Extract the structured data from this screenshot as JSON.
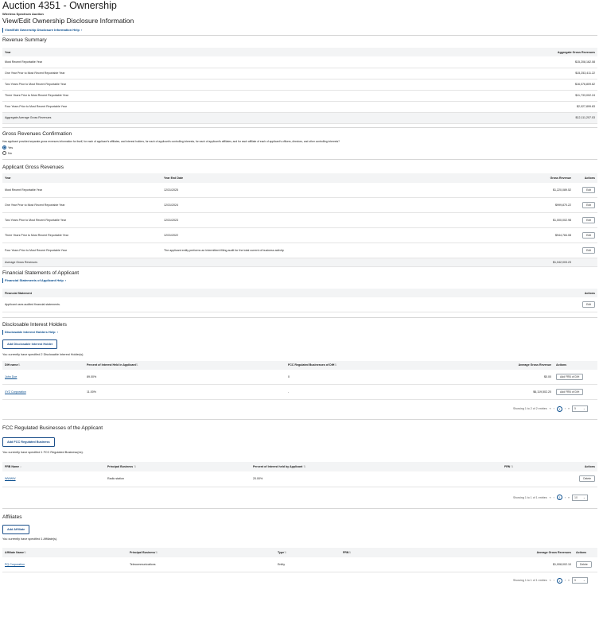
{
  "header": {
    "title": "Auction 4351 - Ownership",
    "subtitle": "Wireless Spectrum Auction",
    "heading": "View/Edit Ownership Disclosure Information",
    "help_link": "View/Edit Ownership Disclosure Information Help"
  },
  "revenue_summary": {
    "title": "Revenue Summary",
    "col_year": "Year",
    "col_agg": "Aggregate Gross Revenues",
    "rows": [
      {
        "year": "Most Recent Reportable Year",
        "value": "$15,208,162.08"
      },
      {
        "year": "One Year Prior to Most Recent Reportable Year",
        "value": "$15,253,411.22"
      },
      {
        "year": "Two Years Prior to Most Recent Reportable Year",
        "value": "$16,076,809.62"
      },
      {
        "year": "Three Years Prior to Most Recent Reportable Year",
        "value": "$11,733,002.24"
      },
      {
        "year": "Four Years Prior to Most Recent Reportable Year",
        "value": "$2,027,899.83"
      },
      {
        "year": "Aggregate Average Gross Revenues",
        "value": "$12,111,207.03"
      }
    ]
  },
  "confirmation": {
    "title": "Gross Revenues Confirmation",
    "question": "Has applicant provided separate gross revenues information for itself, for each of applicant's affiliates, and interest holders, for each of applicant's controlling interests, for each of applicant's affiliates, and for each affiliate of each of applicant's officers, directors, and other controlling interests?",
    "yes": "Yes",
    "no": "No"
  },
  "applicant_revenues": {
    "title": "Applicant Gross Revenues",
    "col_year": "Year",
    "col_end": "Year End Date",
    "col_rev": "Gross Revenue",
    "col_actions": "Actions",
    "rows": [
      {
        "year": "Most Recent Reportable Year",
        "end": "12/31/2025",
        "rev": "$1,220,089.52",
        "action": "Edit"
      },
      {
        "year": "One Year Prior to Most Recent Reportable Year",
        "end": "12/31/2024",
        "rev": "$999,870.22",
        "action": "Edit"
      },
      {
        "year": "Two Years Prior to Most Recent Reportable Year",
        "end": "12/31/2023",
        "rev": "$1,000,002.98",
        "action": "Edit"
      },
      {
        "year": "Three Years Prior to Most Recent Reportable Year",
        "end": "12/31/2022",
        "rev": "$944,784.08",
        "action": "Edit"
      },
      {
        "year": "Four Years Prior to Most Recent Reportable Year",
        "end": "The applicant entity performs an Intermittent filling audit for the total current of business activity.",
        "rev": "",
        "action": "Edit"
      }
    ],
    "avg_label": "Average Gross Revenues",
    "avg_value": "$1,042,003.23"
  },
  "financial": {
    "title": "Financial Statements of Applicant",
    "help_link": "Financial Statements of Applicant Help",
    "col_statement": "Financial Statement",
    "col_actions": "Actions",
    "row": "Applicant uses audited financial statements.",
    "action": "Edit"
  },
  "disclosable": {
    "title": "Disclosable Interest Holders",
    "help_link": "Disclosable Interest Holders Help",
    "add_button": "Add Disclosable Interest Holder",
    "count_text": "You currently have specified 2 Disclosable Interest Holder(s).",
    "col_name": "DIH name",
    "col_pct": "Percent of Interest Held in Applicant",
    "col_fcc": "FCC Regulated Businesses of DIH",
    "col_avg": "Average Gross Revenue",
    "col_actions": "Actions",
    "rows": [
      {
        "name": "John Doe",
        "pct": "89.00%",
        "fcc": "0",
        "avg": "$0.00",
        "action": "Add FRB of DIH"
      },
      {
        "name": "XYZ Corporation",
        "pct": "11.00%",
        "fcc": "-",
        "avg": "$6,119,502.20",
        "action": "Add FRB of DIH"
      }
    ],
    "showing": "Showing 1 to 2 of 2 entries",
    "page": "1",
    "per_page": "5"
  },
  "fcc_regulated": {
    "title": "FCC Regulated Businesses of the Applicant",
    "add_button": "Add FCC Regulated Business",
    "count_text": "You currently have specified 1 FCC Regulated Business(es).",
    "col_name": "FRB Name",
    "col_principal": "Principal Business",
    "col_pct": "Percent of Interest held by Applicant",
    "col_frn": "FRN",
    "col_actions": "Actions",
    "rows": [
      {
        "name": "WWWW",
        "principal": "Radio station",
        "pct": "20.00%",
        "frn": "",
        "action": "Delete"
      }
    ],
    "showing": "Showing 1 to 1 of 1 entries",
    "page": "1",
    "per_page": "10"
  },
  "affiliates": {
    "title": "Affiliates",
    "add_button": "Add Affiliate",
    "count_text": "You currently have specified 1 Affiliate(s).",
    "col_name": "Affiliate Name",
    "col_principal": "Principal Business",
    "col_type": "Type",
    "col_frn": "FRN",
    "col_avg": "Average Gross Revenues",
    "col_actions": "Actions",
    "rows": [
      {
        "name": "PQ Corporation",
        "principal": "Telecommunications",
        "type": "Entity",
        "frn": "",
        "avg": "$1,008,002.10",
        "action": "Delete"
      }
    ],
    "showing": "Showing 1 to 1 of 1 entries",
    "page": "1",
    "per_page": "5"
  }
}
